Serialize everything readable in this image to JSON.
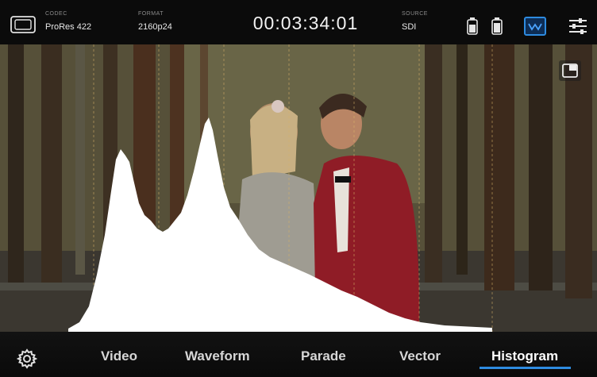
{
  "top_bar": {
    "codec_label": "CODEC",
    "codec_value": "ProRes 422",
    "format_label": "FORMAT",
    "format_value": "2160p24",
    "timecode": "00:03:34:01",
    "source_label": "SOURCE",
    "source_value": "SDI"
  },
  "icons": {
    "frame_guides": "frame-guides-icon",
    "battery": "battery-icon",
    "scope": "scope-icon",
    "sliders": "sliders-icon",
    "pip": "picture-in-picture-icon",
    "settings": "gear-icon"
  },
  "scope_tabs": {
    "active": "Histogram",
    "items": [
      {
        "label": "Video"
      },
      {
        "label": "Waveform"
      },
      {
        "label": "Parade"
      },
      {
        "label": "Vector"
      },
      {
        "label": "Histogram"
      }
    ]
  },
  "colors": {
    "accent": "#2e8be0",
    "histogram_fill": "#ffffff"
  }
}
